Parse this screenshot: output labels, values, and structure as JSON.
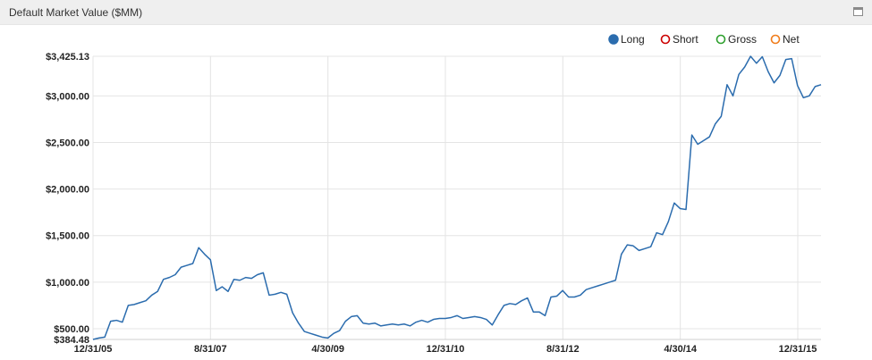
{
  "panel": {
    "title": "Default Market Value ($MM)",
    "maximize_icon": "window-maximize-icon"
  },
  "colors": {
    "long": "#2b6cae",
    "short": "#cc0000",
    "gross": "#2ea02e",
    "net": "#f07c1a",
    "grid": "#e4e4e4"
  },
  "chart_data": {
    "type": "line",
    "legend": [
      "Long",
      "Short",
      "Gross",
      "Net"
    ],
    "legend_position": "top-right",
    "grid": true,
    "x_ticks": [
      "12/31/05",
      "8/31/07",
      "4/30/09",
      "12/31/10",
      "8/31/12",
      "4/30/14",
      "12/31/15"
    ],
    "y_ticks": [
      "$3,425.13",
      "$3,000.00",
      "$2,500.00",
      "$2,000.00",
      "$1,500.00",
      "$1,000.00",
      "$500.00",
      "$384.48"
    ],
    "ylim": [
      384.48,
      3425.13
    ],
    "series": [
      {
        "name": "Long",
        "values": [
          384.48,
          400,
          410,
          580,
          590,
          570,
          750,
          760,
          780,
          800,
          860,
          900,
          1030,
          1050,
          1080,
          1160,
          1180,
          1200,
          1370,
          1300,
          1240,
          910,
          950,
          900,
          1030,
          1020,
          1050,
          1040,
          1080,
          1100,
          860,
          870,
          890,
          870,
          670,
          560,
          470,
          450,
          430,
          410,
          400,
          450,
          480,
          580,
          630,
          640,
          560,
          550,
          560,
          530,
          540,
          550,
          540,
          550,
          530,
          570,
          590,
          570,
          600,
          610,
          610,
          620,
          640,
          610,
          620,
          630,
          620,
          600,
          540,
          650,
          750,
          770,
          760,
          800,
          830,
          680,
          680,
          640,
          840,
          850,
          910,
          840,
          840,
          860,
          920,
          940,
          960,
          980,
          1000,
          1020,
          1300,
          1400,
          1390,
          1340,
          1360,
          1380,
          1530,
          1510,
          1650,
          1850,
          1790,
          1780,
          2580,
          2480,
          2520,
          2560,
          2700,
          2780,
          3120,
          3000,
          3230,
          3310,
          3425.13,
          3350,
          3420,
          3260,
          3140,
          3220,
          3390,
          3400,
          3110,
          2980,
          3000,
          3100,
          3120
        ]
      }
    ]
  }
}
